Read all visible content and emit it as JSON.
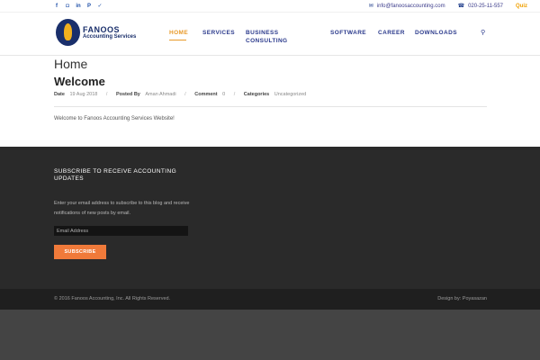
{
  "topbar": {
    "social": [
      {
        "icon": "facebook-icon",
        "glyph": "f"
      },
      {
        "icon": "instagram-icon",
        "glyph": "◘"
      },
      {
        "icon": "linkedin-icon",
        "glyph": "in"
      },
      {
        "icon": "pinterest-icon",
        "glyph": "P"
      },
      {
        "icon": "twitter-icon",
        "glyph": "✓"
      }
    ],
    "email": "info@fanoosaccounting.com",
    "phone": "020-25-11-557",
    "quiz": "Quiz"
  },
  "logo": {
    "title": "FANOOS",
    "subtitle": "Accounting Services"
  },
  "nav": {
    "items": [
      {
        "label": "HOME",
        "active": true
      },
      {
        "label": "SERVICES"
      },
      {
        "label": "BUSINESS\nCONSULTING"
      },
      {
        "label": "SOFTWARE"
      },
      {
        "label": "CAREER"
      },
      {
        "label": "DOWNLOADS"
      }
    ]
  },
  "page": {
    "title": "Home",
    "post_title": "Welcome",
    "meta": {
      "date_label": "Date",
      "date": "19 Aug 2018",
      "posted_label": "Posted By",
      "author": "Aman Ahmadi",
      "comment_label": "Comment",
      "comment_count": "0",
      "categories_label": "Categories",
      "category": "Uncategorized"
    },
    "content": "Welcome to Fanoos Accounting Services Website!"
  },
  "footer": {
    "subscribe_title": "SUBSCRIBE TO RECEIVE ACCOUNTING UPDATES",
    "subscribe_text": "Enter your email address to subscribe to this blog and receive notifications of new posts by email.",
    "email_placeholder": "Email Address",
    "subscribe_button": "SUBSCRIBE",
    "copyright": "© 2016 Fanoos Accounting, Inc. All Rights Reserved.",
    "design_by": "Design by: Poyasazan"
  },
  "colors": {
    "brand_blue": "#1a2f6b",
    "nav_blue": "#2b3a8c",
    "accent_orange": "#e89a2a",
    "button_orange": "#f07a3a",
    "quiz_yellow": "#f0a000",
    "footer_bg": "#2a2a2a"
  }
}
